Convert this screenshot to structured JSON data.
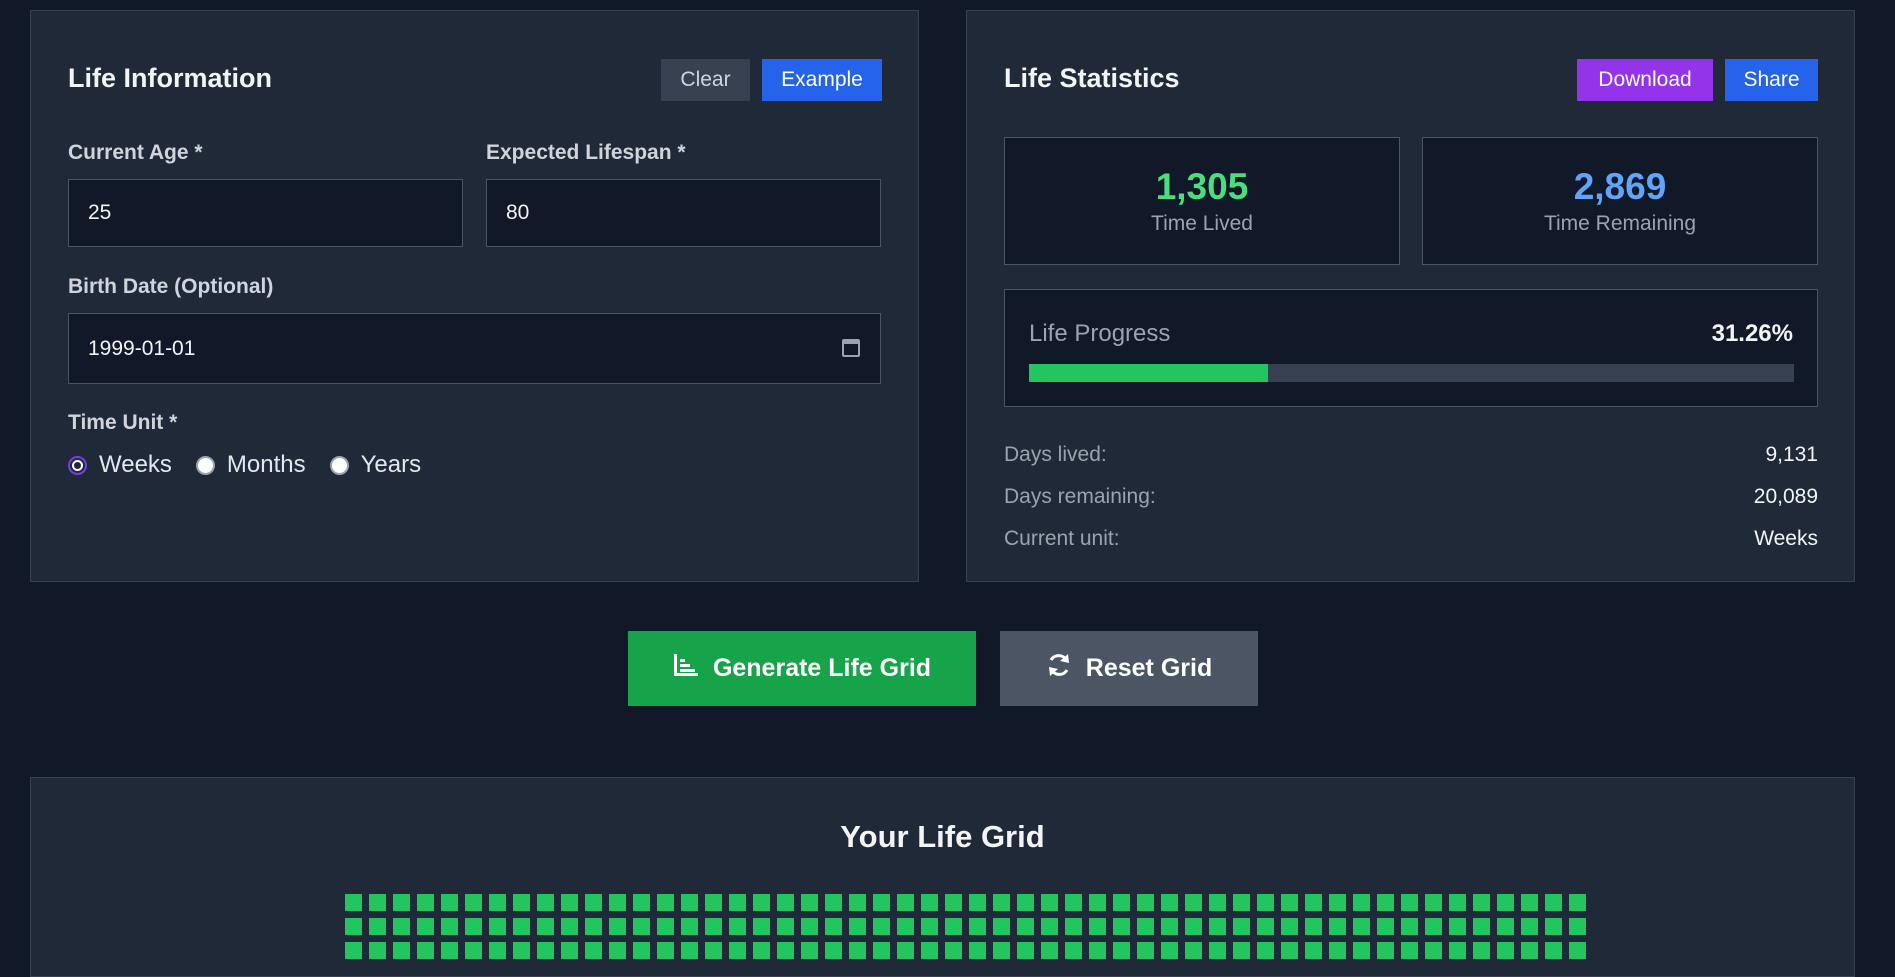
{
  "life_info": {
    "title": "Life Information",
    "clear_label": "Clear",
    "example_label": "Example",
    "age_label": "Current Age *",
    "age_value": "25",
    "lifespan_label": "Expected Lifespan *",
    "lifespan_value": "80",
    "birth_label": "Birth Date (Optional)",
    "birth_value": "1999-01-01",
    "unit_label": "Time Unit *",
    "units": [
      {
        "label": "Weeks",
        "checked": true
      },
      {
        "label": "Months",
        "checked": false
      },
      {
        "label": "Years",
        "checked": false
      }
    ]
  },
  "stats": {
    "title": "Life Statistics",
    "download_label": "Download",
    "share_label": "Share",
    "lived_value": "1,305",
    "lived_label": "Time Lived",
    "remaining_value": "2,869",
    "remaining_label": "Time Remaining",
    "progress_label": "Life Progress",
    "progress_pct": "31.26%",
    "progress_fraction": 0.3126,
    "details": [
      {
        "key": "Days lived:",
        "value": "9,131"
      },
      {
        "key": "Days remaining:",
        "value": "20,089"
      },
      {
        "key": "Current unit:",
        "value": "Weeks"
      }
    ]
  },
  "actions": {
    "generate_label": "Generate Life Grid",
    "reset_label": "Reset Grid"
  },
  "grid": {
    "title": "Your Life Grid",
    "visible_rows": 3,
    "columns": 52,
    "filled_color": "#22c55e"
  },
  "colors": {
    "background": "#111827",
    "panel": "#1f2937",
    "accent_green": "#22c55e",
    "accent_blue": "#2563eb",
    "accent_purple": "#9333ea"
  }
}
